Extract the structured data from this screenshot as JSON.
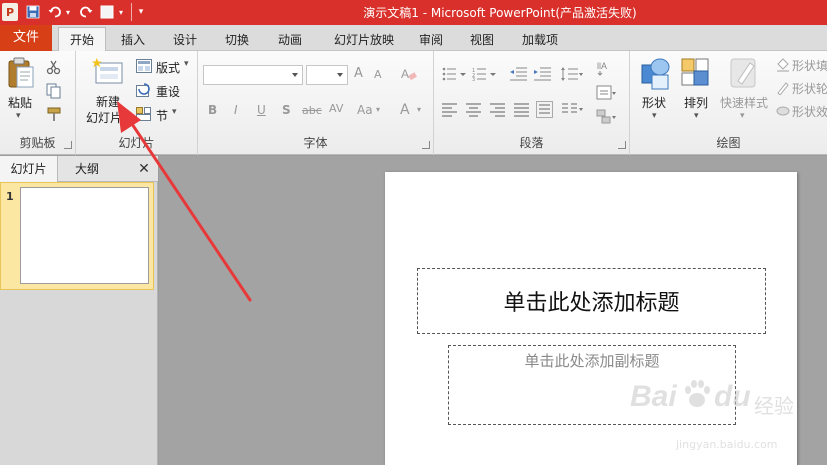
{
  "titlebar": {
    "title": "演示文稿1 - Microsoft PowerPoint(产品激活失败)",
    "app_icon": "P",
    "save_icon": "save-icon",
    "undo_icon": "undo-icon",
    "redo_icon": "redo-icon"
  },
  "tabs": {
    "file": "文件",
    "items": [
      "开始",
      "插入",
      "设计",
      "切换",
      "动画",
      "幻灯片放映",
      "审阅",
      "视图",
      "加载项"
    ]
  },
  "ribbon": {
    "clipboard": {
      "paste_label": "粘贴",
      "group_label": "剪贴板"
    },
    "slides": {
      "new_label_line1": "新建",
      "new_label_line2": "幻灯片",
      "layout_label": "版式",
      "reset_label": "重设",
      "section_label": "节",
      "group_label": "幻灯片"
    },
    "font": {
      "group_label": "字体",
      "bold": "B",
      "italic": "I",
      "underline": "U",
      "shadow": "S",
      "strike": "abc",
      "spacing": "AV",
      "case": "Aa",
      "grow": "A",
      "shrink": "A"
    },
    "paragraph": {
      "group_label": "段落"
    },
    "drawing": {
      "shapes_label": "形状",
      "arrange_label": "排列",
      "quick_styles_label": "快速样式",
      "fill_label": "形状填",
      "outline_label": "形状轮",
      "effects_label": "形状效",
      "group_label": "绘图"
    }
  },
  "leftpanel": {
    "tab_slides": "幻灯片",
    "tab_outline": "大纲",
    "close": "✕",
    "slide_number": "1"
  },
  "slide": {
    "title_placeholder": "单击此处添加标题",
    "subtitle_placeholder": "单击此处添加副标题"
  },
  "watermark": {
    "brand": "Bai",
    "brand2": "du",
    "product": "经验",
    "url": "jingyan.baidu.com"
  },
  "colors": {
    "titlebar": "#d9302b",
    "file_tab": "#d73f16",
    "arrow": "#e8393a",
    "selection": "#fbe7a2"
  }
}
